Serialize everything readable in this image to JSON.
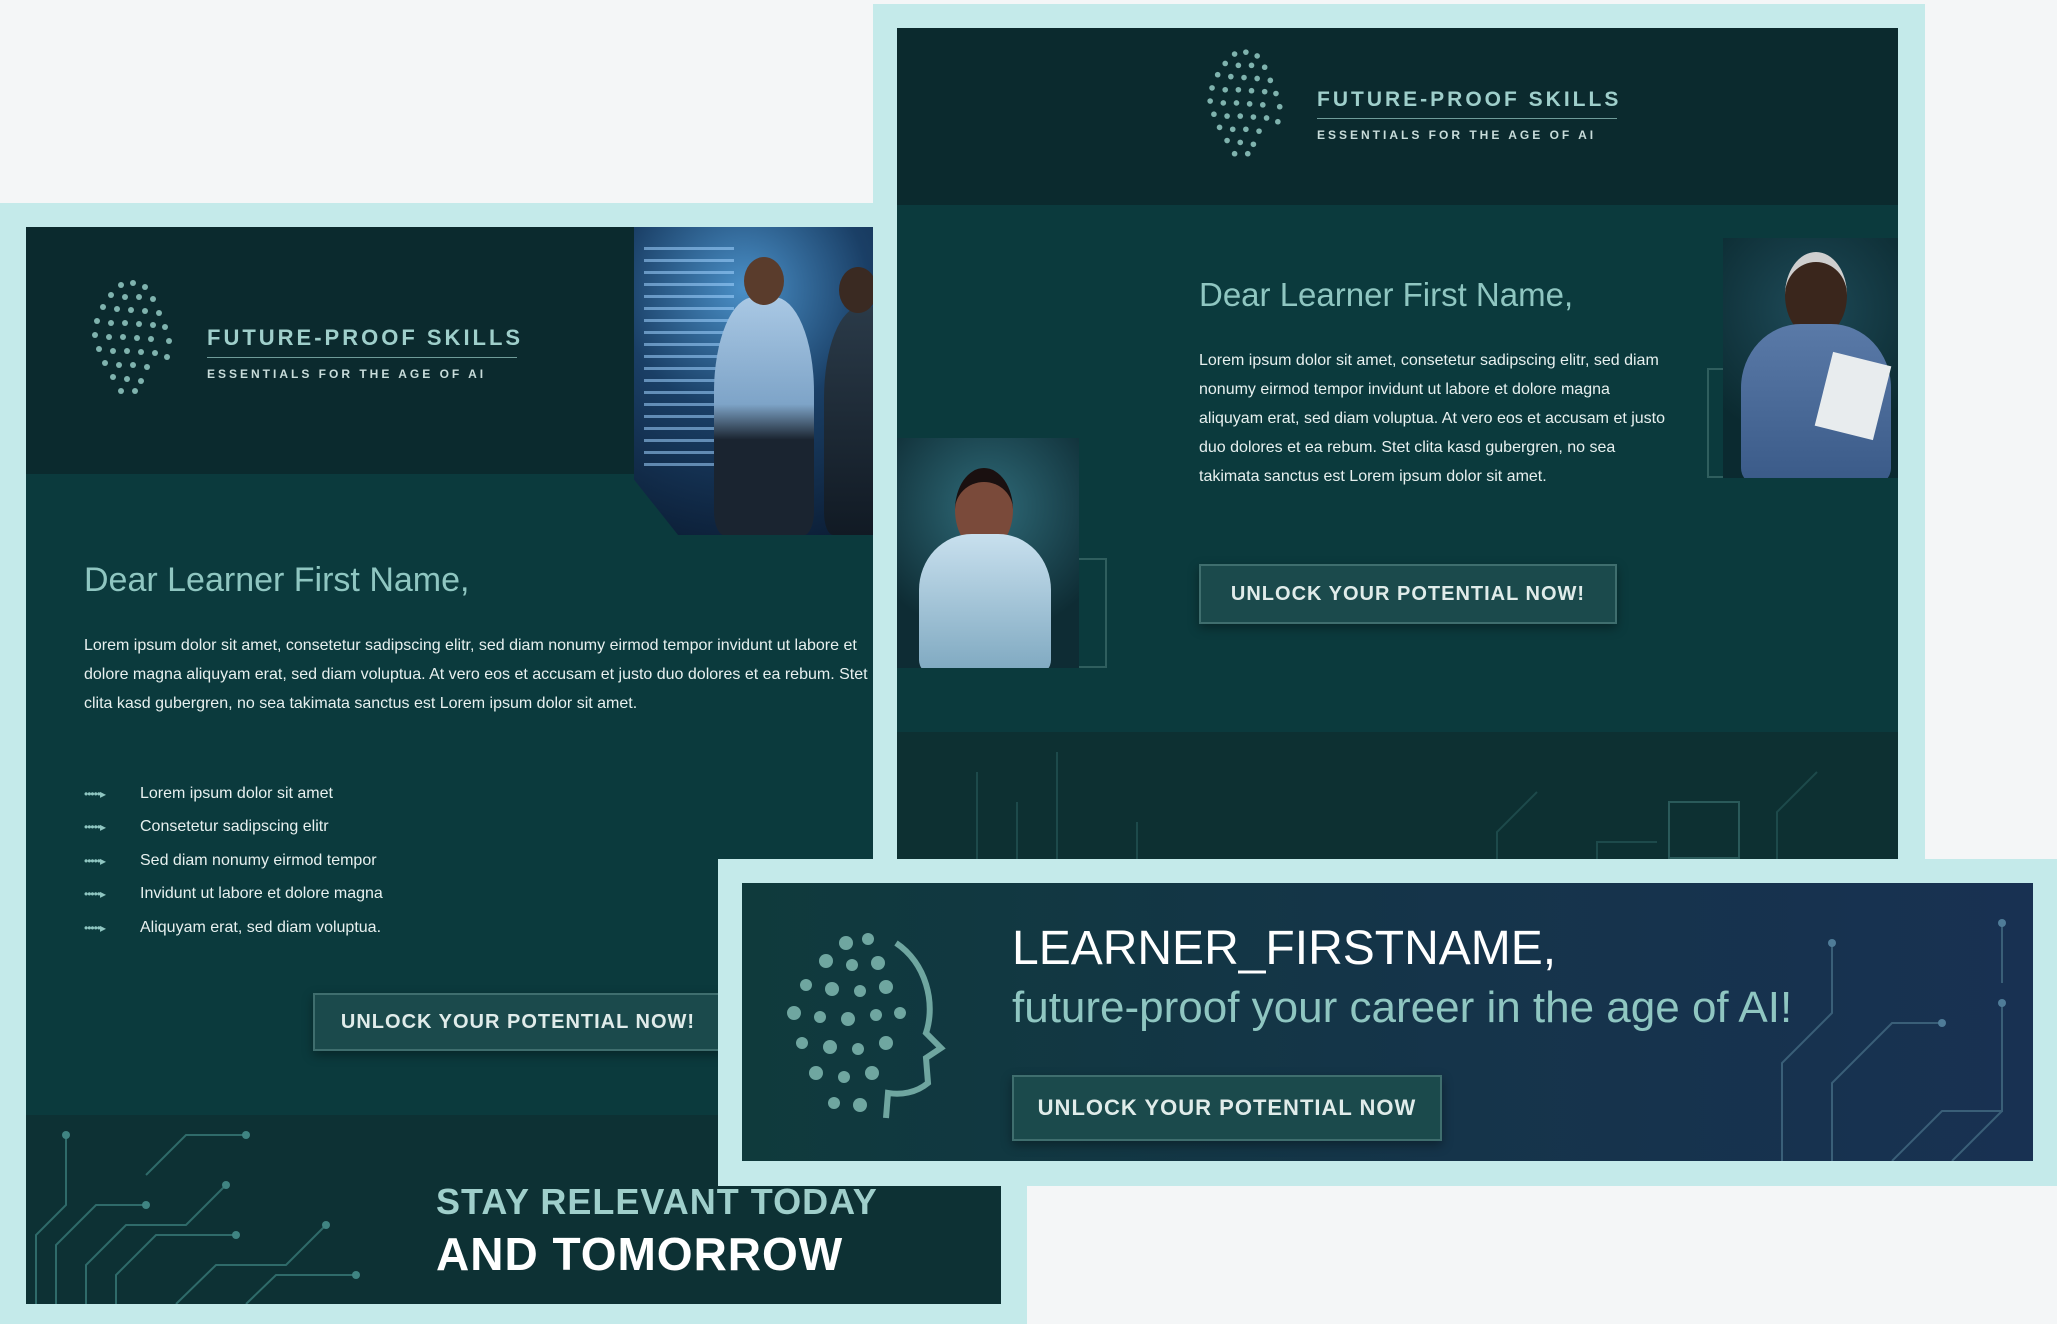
{
  "card1": {
    "logo": {
      "title": "FUTURE-PROOF SKILLS",
      "subtitle": "ESSENTIALS FOR THE AGE OF AI"
    },
    "greeting": "Dear Learner First Name,",
    "body": "Lorem ipsum dolor sit amet, consetetur sadipscing elitr, sed diam nonumy eirmod tempor invidunt ut labore et dolore magna aliquyam erat, sed diam voluptua. At vero eos et accusam et justo duo dolores et ea rebum. Stet clita kasd gubergren, no sea takimata sanctus est Lorem ipsum dolor sit amet.",
    "bullets": [
      "Lorem ipsum dolor sit amet",
      "Consetetur sadipscing elitr",
      "Sed diam nonumy eirmod tempor",
      "Invidunt ut labore et dolore magna",
      "Aliquyam erat, sed diam voluptua."
    ],
    "cta": "UNLOCK YOUR POTENTIAL NOW!",
    "footer": {
      "line1": "STAY RELEVANT TODAY",
      "line2": "AND TOMORROW"
    }
  },
  "card2": {
    "logo": {
      "title": "FUTURE-PROOF SKILLS",
      "subtitle": "ESSENTIALS FOR THE AGE OF AI"
    },
    "greeting": "Dear Learner First Name,",
    "body": "Lorem ipsum dolor sit amet, consetetur sadipscing elitr, sed diam nonumy eirmod tempor invidunt ut labore et dolore magna aliquyam erat, sed diam voluptua. At vero eos et accusam et justo duo dolores et ea rebum. Stet clita kasd gubergren, no sea takimata sanctus est Lorem ipsum dolor sit amet.",
    "cta": "UNLOCK YOUR POTENTIAL NOW!"
  },
  "card3": {
    "name": "LEARNER_FIRSTNAME,",
    "tagline": "future-proof your career in the age of AI!",
    "cta": "UNLOCK YOUR POTENTIAL NOW"
  },
  "colors": {
    "frame": "#c4eaea",
    "panel": "#0b3a3d",
    "header": "#0b2a2e",
    "accent": "#8fc6c1"
  },
  "icons": [
    "brain-network-icon",
    "circuit-pattern",
    "bullet-dots-icon",
    "chip-icon"
  ]
}
